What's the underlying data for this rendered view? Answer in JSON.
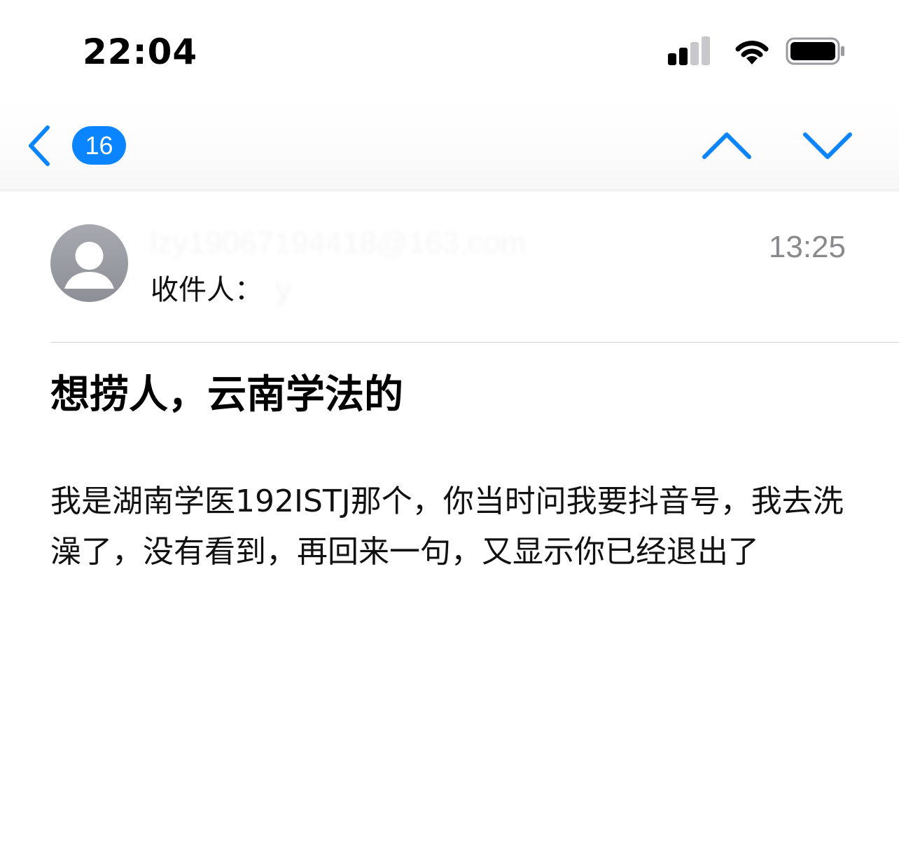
{
  "status_bar": {
    "time": "22:04"
  },
  "nav": {
    "unread_count": "16",
    "accent_color": "#0a84ff",
    "icons": [
      "chevron-left-icon",
      "chevron-up-icon",
      "chevron-down-icon"
    ]
  },
  "message": {
    "sender": "lzy19067194418@163.com",
    "time": "13:25",
    "recipient_label": "收件人：",
    "recipient_value": "y",
    "subject": "想捞人，云南学法的",
    "body": "我是湖南学医192ISTJ那个，你当时问我要抖音号，我去洗澡了，没有看到，再回来一句，又显示你已经退出了"
  }
}
